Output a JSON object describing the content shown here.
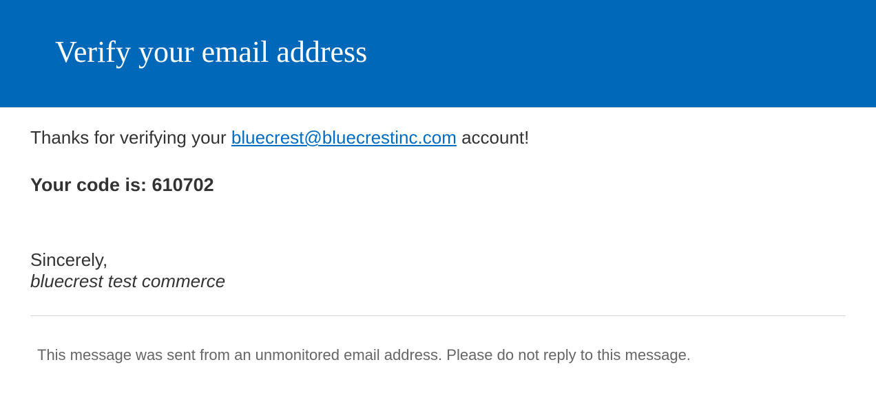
{
  "header": {
    "title": "Verify your email address"
  },
  "body": {
    "thanks_prefix": "Thanks for verifying your ",
    "email": "bluecrest@bluecrestinc.com",
    "thanks_suffix": " account!",
    "code_label": "Your code is: ",
    "code_value": "610702",
    "sincerely": "Sincerely,",
    "sender": "bluecrest test commerce"
  },
  "footer": {
    "disclaimer": "This message was sent from an unmonitored email address. Please do not reply to this message."
  }
}
